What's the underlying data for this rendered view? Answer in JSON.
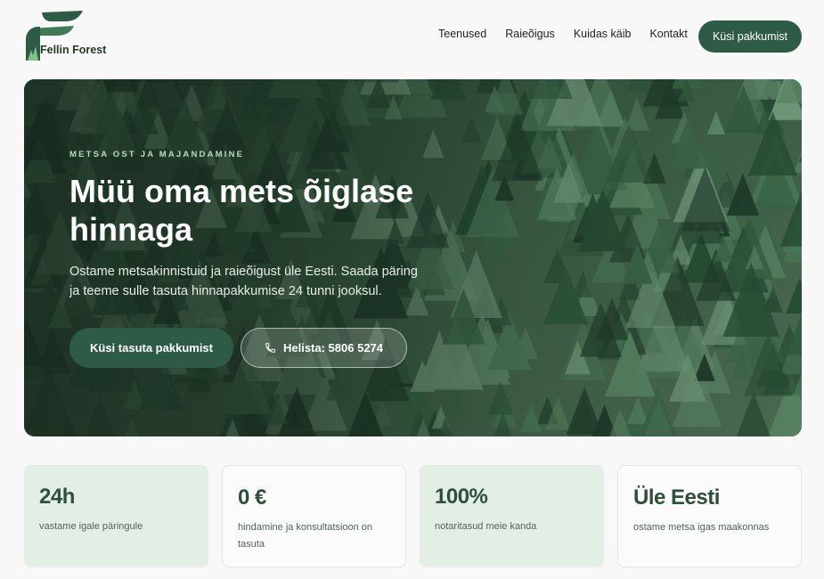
{
  "brand": {
    "name": "Fellin Forest",
    "colors": {
      "primary": "#2e5b45",
      "accent": "#b9dbc0",
      "tint": "#e3efe5"
    }
  },
  "nav": {
    "items": [
      "Teenused",
      "Raieõigus",
      "Kuidas käib",
      "Kontakt"
    ],
    "cta": "Küsi pakkumist"
  },
  "hero": {
    "eyebrow": "METSA OST JA MAJANDAMINE",
    "title": "Müü oma mets õiglase hinnaga",
    "subtitle": "Ostame metsakinnistuid ja raieõigust üle Eesti. Saada päring ja teeme sulle tasuta hinnapakkumise 24 tunni jooksul.",
    "primary_button": "Küsi tasuta pakkumist",
    "phone_button": "Helista: 5806 5274",
    "phone_icon": "phone-icon",
    "background": "aerial-forest-image"
  },
  "stats": [
    {
      "value": "24h",
      "label": "vastame igale päringule"
    },
    {
      "value": "0 €",
      "label": "hindamine ja konsultatsioon on tasuta"
    },
    {
      "value": "100%",
      "label": "notaritasud meie kanda"
    },
    {
      "value": "Üle Eesti",
      "label": "ostame metsa igas maakonnas"
    }
  ]
}
